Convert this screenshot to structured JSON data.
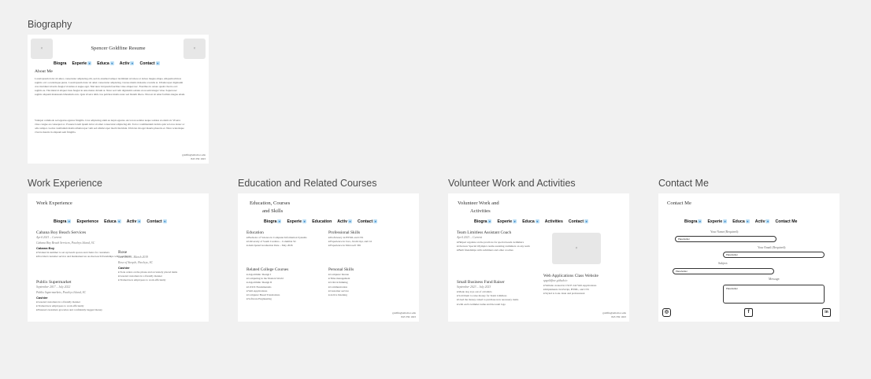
{
  "frames": {
    "biography": {
      "label": "Biography",
      "title": "Spencer Goldfine Resume",
      "nav": [
        "Biogra",
        "Experie",
        "Educa",
        "Activ",
        "Contact"
      ],
      "section_title": "About Me",
      "para1": "Lorem ipsum dolor sit amet, consectetur adipiscing elit, sed do eiusmod tempor incididunt ut labore et dolore magna aliqua. Aliquam ultrices sagittis orci a scelerisque purus. Lorem ipsum dolor sit amet consectetur adipiscing. Cursus mattis molestie a iaculis at. Ullamcorper dignissim cras tincidunt lobortis feugiat vivamus at augue eget. Nisl nunc mi ipsum faucibus vitae aliquet nec. Faucibus in ornare quam viverra orci sagittis eu. Tincidunt id aliquet risus feugiat in ante metus dictum at. Nunc sed velit dignissim sodales ut eu sem integer vitae. Sapien nec sagittis aliquam malesuada bibendum arcu. Quis viverra nibh cras pulvinar mattis nunc sed blandit libero. Nisi est sit amet facilisis magna etiam.",
      "para2": "Volutpat commodo sed egestas egestas fringilla. Cras adipiscing enim eu turpis egestas. Arcu non sodales neque sodales ut etiam sit. Viverra vitae congue eu consequat ac. Posuere lorem ipsum dolor sit amet consectetur adipiscing elit. Tortor condimentum lacinia quis vel eros donec ac odio tempor. Lectus vestibulum mattis ullamcorper velit sed ullamcorper morbi tincidunt. Ultricies mi eget mauris pharetra et. Nunc scelerisque viverra mauris in aliquam sem fringilla.",
      "email": "goldfin@email.sc.edu",
      "phone": "843 359 1023"
    },
    "work": {
      "label": "Work Experience",
      "title": "Work Experience",
      "nav": [
        "Biogra",
        "Experience",
        "Educa",
        "Activ",
        "Contact"
      ],
      "job1_title": "Cabana Boy Beach Services",
      "job1_dates": "April 2021 – Current",
      "job1_place": "Cabana Boy Beach Services, Pawleys Island, SC",
      "job1_sub": "Cabana Boy",
      "job1_bullets": [
        "Worked in summer to set up beach spaces and chairs for customers",
        "Provided customer service and maintained an on-the-beach friendships with community"
      ],
      "job2_title": "Rose",
      "job2_dates": "June 2018 – March 2019",
      "job2_place": "Rose of Steeple, Pawleys, SC",
      "job2_sub": "Cashier",
      "job2_bullets": [
        "Took orders on the phone and accurately placed items",
        "Greeted customers in a friendly manner",
        "Trained new employees to work efficiently"
      ],
      "job3_title": "Publix Supermarket",
      "job3_dates": "September 2017 – July 2022",
      "job3_place": "Publix Supermarkets, Pawleys Island, SC",
      "job3_sub": "Cashier",
      "job3_bullets": [
        "Greeted customers in a friendly manner",
        "Trained new employees to work efficiently",
        "Ensured customers groceries and confidently bagged money"
      ]
    },
    "education": {
      "label": "Education and Related Courses",
      "title_line1": "Education, Courses",
      "title_line2": "and Skills",
      "nav": [
        "Biogra",
        "Experie",
        "Education",
        "Activ",
        "Contact"
      ],
      "edu_title": "Education",
      "edu_bullets": [
        "Bachelor of Science in Computer Information Systems",
        "University of South Carolina – Columbia SC",
        "Anticipated Graduation Date – May 2026"
      ],
      "prof_title": "Professional Skills",
      "prof_bullets": [
        "Proficiency in HTML and CSS",
        "Experience in Java, JavaScript, and C#",
        "Experience in Microsoft 365"
      ],
      "courses_title": "Related College Courses",
      "courses_bullets": [
        "Algorithmic Design I",
        "Computing in the Modern World",
        "Algorithmic Design II",
        "UI/UX Fundamentals",
        "Web Applications",
        "Computer Based Translations",
        "Software Engineering"
      ],
      "personal_title": "Personal Skills",
      "personal_bullets": [
        "Computer literate",
        "Time management",
        "Critical thinking",
        "Communication",
        "Customer service",
        "Active listening"
      ]
    },
    "volunteer": {
      "label": "Volunteer Work and Activities",
      "title_line1": "Volunteer Work and",
      "title_line2": "Activities",
      "nav": [
        "Biogra",
        "Experie",
        "Educa",
        "Activities",
        "Contact"
      ],
      "v1_title": "Team Limitless Assistant Coach",
      "v1_dates": "April 2021 – Current",
      "v1_bullets": [
        "Helped organize on the practices for special needs swimmers",
        "Oversaw Special Olympics teams assisting swimmers on any team",
        "Built friendships with swimmers and other coaches"
      ],
      "v2_title": "Small Business Fund Raiser",
      "v2_dates": "September 2023 – July 2023",
      "v2_bullets": [
        "Made dog toys out of old shirts",
        "Sold them to raise money for Team Limitless",
        "Used the money raised to purchase new necessary items",
        "with each swimmer name and the team logo"
      ],
      "v3_title": "Web Applications Class Website",
      "v3_sub": "spgoldfine.github.io",
      "v3_bullets": [
        "Website created in CSCE 242 Web Applications",
        "Implements JavaScript, HTML, and CSS",
        "Styled to look clean and professional"
      ]
    },
    "contact": {
      "label": "Contact Me",
      "title": "Contact Me",
      "nav": [
        "Biogra",
        "Experie",
        "Educa",
        "Activ",
        "Contact Me"
      ],
      "name_label": "Your Name (Required):",
      "email_label": "Your Email (Required):",
      "subject_label": "Subject:",
      "message_label": "Message:",
      "placeholder": "Placeholder"
    }
  }
}
